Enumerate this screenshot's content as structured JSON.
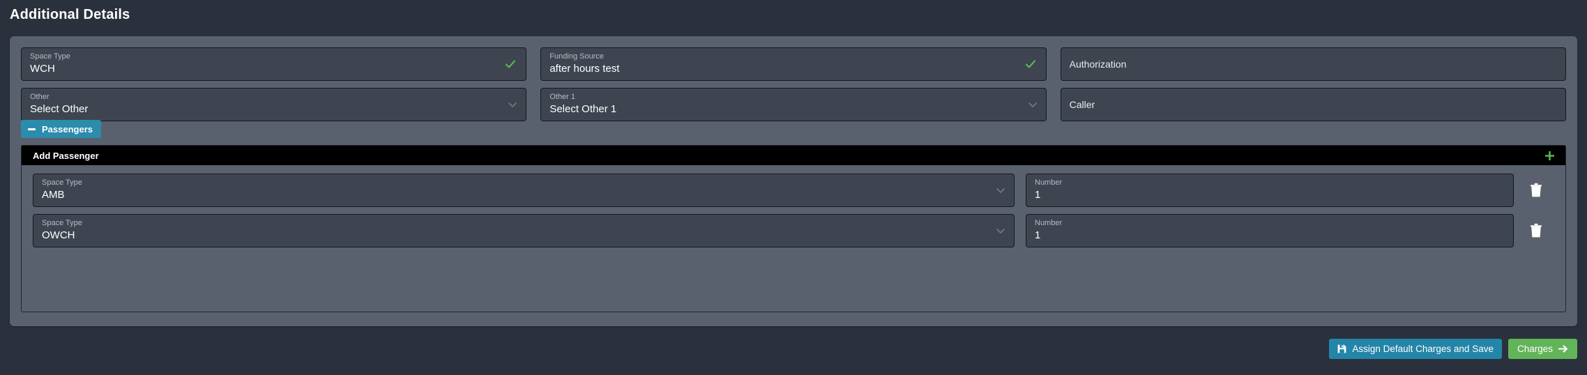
{
  "section": {
    "title": "Additional Details"
  },
  "fields": [
    {
      "label": "Space Type",
      "value": "WCH",
      "status": "valid",
      "control": "text",
      "placeholder_only": false
    },
    {
      "label": "Funding Source",
      "value": "after hours test",
      "status": "valid",
      "control": "text",
      "placeholder_only": false
    },
    {
      "label": "",
      "value": "Authorization",
      "status": "none",
      "control": "text",
      "placeholder_only": true
    },
    {
      "label": "Other",
      "value": "Select Other",
      "status": "none",
      "control": "dropdown",
      "placeholder_only": false
    },
    {
      "label": "Other 1",
      "value": "Select Other 1",
      "status": "none",
      "control": "dropdown",
      "placeholder_only": false
    },
    {
      "label": "",
      "value": "Caller",
      "status": "none",
      "control": "text",
      "placeholder_only": true
    }
  ],
  "passengers_toggle": {
    "label": "Passengers",
    "icon": "minus-icon",
    "expanded": true
  },
  "passengers": {
    "header": {
      "title": "Add Passenger",
      "add_icon": "plus-icon"
    },
    "rows": [
      {
        "space_type_label": "Space Type",
        "space_type_value": "AMB",
        "number_label": "Number",
        "number_value": "1",
        "delete_icon": "trash-icon"
      },
      {
        "space_type_label": "Space Type",
        "space_type_value": "OWCH",
        "number_label": "Number",
        "number_value": "1",
        "delete_icon": "trash-icon"
      }
    ]
  },
  "footer": {
    "assign_label": "Assign Default Charges and Save",
    "assign_icon": "save-icon",
    "charges_label": "Charges",
    "charges_icon": "arrow-right-icon"
  },
  "colors": {
    "background": "#2b313c",
    "panel": "#5a616e",
    "field": "#3f4550",
    "accent_teal": "#2385a8",
    "accent_green": "#62b458",
    "valid_check": "#5cb85c",
    "header_bar": "#000000"
  }
}
